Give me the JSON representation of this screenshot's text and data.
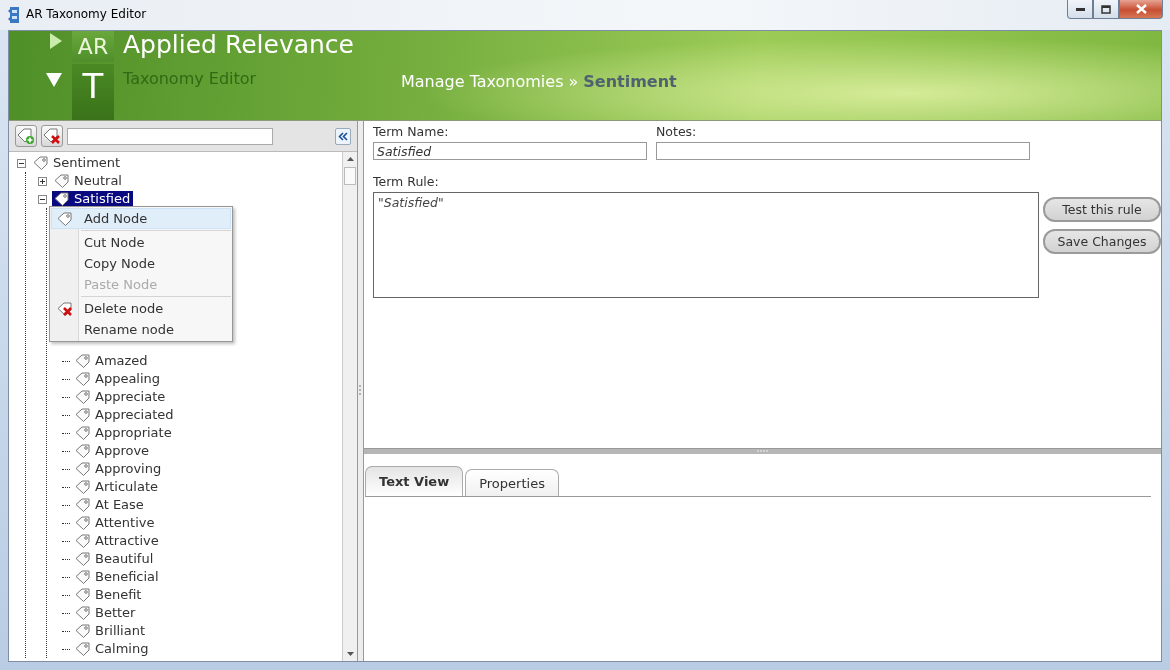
{
  "window": {
    "title": "AR Taxonomy Editor"
  },
  "header": {
    "logo_top": "AR",
    "logo_bottom": "T",
    "brand": "Applied Relevance",
    "product": "Taxonomy Editor",
    "breadcrumb": {
      "path": "Manage Taxonomies",
      "separator": "»",
      "current": "Sentiment"
    }
  },
  "tree": [
    {
      "label": "Sentiment",
      "expanded": true,
      "selected": false,
      "children": [
        {
          "label": "Neutral",
          "expanded": false,
          "selected": false
        },
        {
          "label": "Satisfied",
          "expanded": true,
          "selected": true,
          "children": [
            {
              "label": "Amazed",
              "selected": false
            },
            {
              "label": "Appealing",
              "selected": false
            },
            {
              "label": "Appreciate",
              "selected": false
            },
            {
              "label": "Appreciated",
              "selected": false
            },
            {
              "label": "Appropriate",
              "selected": false
            },
            {
              "label": "Approve",
              "selected": false
            },
            {
              "label": "Approving",
              "selected": false
            },
            {
              "label": "Articulate",
              "selected": false
            },
            {
              "label": "At Ease",
              "selected": false
            },
            {
              "label": "Attentive",
              "selected": false
            },
            {
              "label": "Attractive",
              "selected": false
            },
            {
              "label": "Beautiful",
              "selected": false
            },
            {
              "label": "Beneficial",
              "selected": false
            },
            {
              "label": "Benefit",
              "selected": false
            },
            {
              "label": "Better",
              "selected": false
            },
            {
              "label": "Brilliant",
              "selected": false
            },
            {
              "label": "Calming",
              "selected": false
            }
          ]
        }
      ]
    }
  ],
  "context_menu": {
    "groups": [
      [
        {
          "label": "Add Node",
          "kind": "tag",
          "highlighted": true,
          "disabled": false
        }
      ],
      [
        {
          "label": "Cut Node",
          "highlighted": false,
          "disabled": false
        },
        {
          "label": "Copy Node",
          "highlighted": false,
          "disabled": false
        },
        {
          "label": "Paste Node",
          "highlighted": false,
          "disabled": true
        }
      ],
      [
        {
          "label": "Delete node",
          "kind": "delete",
          "highlighted": false,
          "disabled": false
        },
        {
          "label": "Rename node",
          "highlighted": false,
          "disabled": false
        }
      ]
    ]
  },
  "term_form": {
    "term_name_label": "Term Name:",
    "term_name": "Satisfied",
    "notes_label": "Notes:",
    "term_rule_label": "Term Rule:",
    "term_rule": "\"Satisfied\""
  },
  "buttons": [
    "Test this rule",
    "Save Changes"
  ],
  "tabs": [
    {
      "label": "Text View",
      "selected": true
    },
    {
      "label": "Properties",
      "selected": false
    }
  ]
}
